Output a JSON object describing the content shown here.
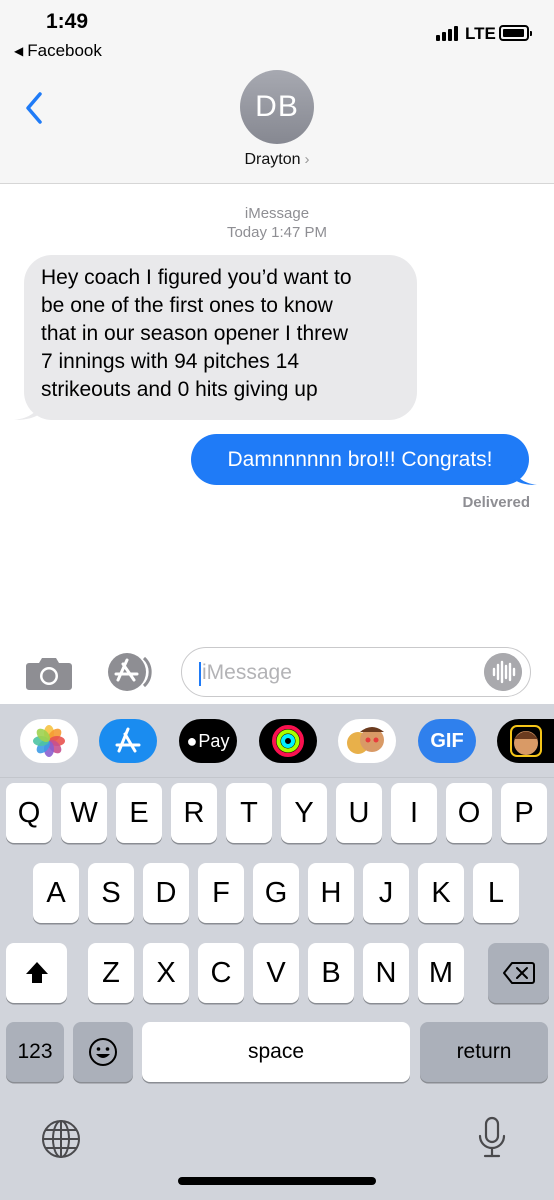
{
  "status_bar": {
    "time": "1:49",
    "back_app": "Facebook",
    "network": "LTE"
  },
  "header": {
    "avatar_initials": "DB",
    "contact_name": "Drayton",
    "chevron": "›"
  },
  "conversation": {
    "service": "iMessage",
    "timestamp": "Today 1:47 PM",
    "messages": [
      {
        "direction": "incoming",
        "lines": [
          "Hey coach I figured you’d want to",
          "be one of the first ones to know",
          "that in our season opener I threw",
          "7 innings with 94 pitches 14",
          "strikeouts and 0 hits giving up"
        ]
      },
      {
        "direction": "outgoing",
        "text": "Damnnnnnn bro!!! Congrats!"
      }
    ],
    "delivery_status": "Delivered"
  },
  "input_bar": {
    "placeholder": "iMessage"
  },
  "app_strip": {
    "apple_pay_label": "Pay",
    "gif_label": "GIF"
  },
  "keyboard": {
    "row1": [
      "Q",
      "W",
      "E",
      "R",
      "T",
      "Y",
      "U",
      "I",
      "O",
      "P"
    ],
    "row2": [
      "A",
      "S",
      "D",
      "F",
      "G",
      "H",
      "J",
      "K",
      "L"
    ],
    "row3": [
      "Z",
      "X",
      "C",
      "V",
      "B",
      "N",
      "M"
    ],
    "numbers_key": "123",
    "space_key": "space",
    "return_key": "return"
  },
  "colors": {
    "accent": "#1f7bf7",
    "incoming_bubble": "#e9e9eb",
    "keyboard_bg": "#d1d4db"
  },
  "icons": [
    "back-chevron-icon",
    "camera-icon",
    "appstore-icon",
    "voice-waveform-icon",
    "photos-icon",
    "applepay-icon",
    "activity-icon",
    "memoji-icon",
    "gif-icon",
    "shift-icon",
    "delete-icon",
    "emoji-icon",
    "globe-icon",
    "microphone-icon"
  ]
}
